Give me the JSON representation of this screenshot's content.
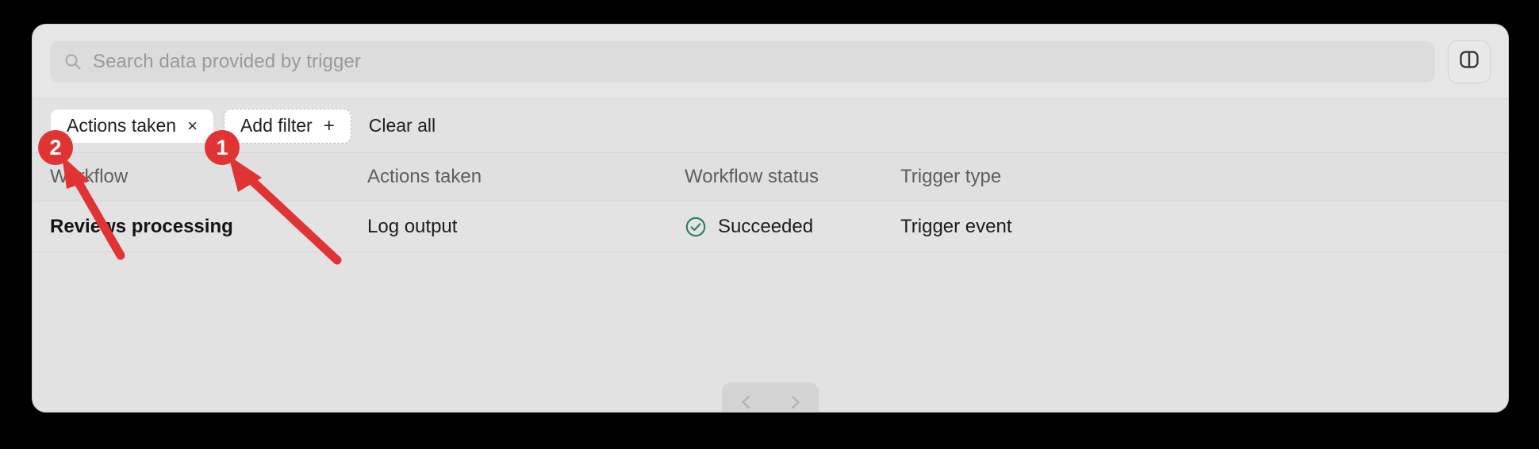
{
  "window": {
    "background_color": "#000000",
    "card_background": "#e2e2e2"
  },
  "search": {
    "placeholder": "Search data provided by trigger",
    "value": "",
    "icon": "search-icon"
  },
  "panel_toggle": {
    "icon": "columns-panel-icon",
    "label": "Toggle side panel"
  },
  "filters": {
    "chips": [
      {
        "label": "Actions taken",
        "remove_glyph": "×",
        "type": "active"
      }
    ],
    "add_filter": {
      "label": "Add filter",
      "glyph": "+"
    },
    "clear_all": {
      "label": "Clear all"
    }
  },
  "table": {
    "columns": [
      {
        "key": "workflow",
        "label": "Workflow"
      },
      {
        "key": "actions_taken",
        "label": "Actions taken"
      },
      {
        "key": "workflow_status",
        "label": "Workflow status"
      },
      {
        "key": "trigger_type",
        "label": "Trigger type"
      }
    ],
    "rows": [
      {
        "workflow": "Reviews processing",
        "actions_taken": "Log output",
        "workflow_status": "Succeeded",
        "workflow_status_icon": "check-circle-icon",
        "workflow_status_color": "#2a7d5f",
        "trigger_type": "Trigger event"
      }
    ]
  },
  "pagination": {
    "prev_icon": "chevron-left-icon",
    "next_icon": "chevron-right-icon",
    "prev_label": "Previous page",
    "next_label": "Next page"
  },
  "annotations": {
    "color": "#e03434",
    "markers": [
      {
        "number": "1",
        "points_to": "Add filter"
      },
      {
        "number": "2",
        "points_to": "Actions taken"
      }
    ]
  }
}
